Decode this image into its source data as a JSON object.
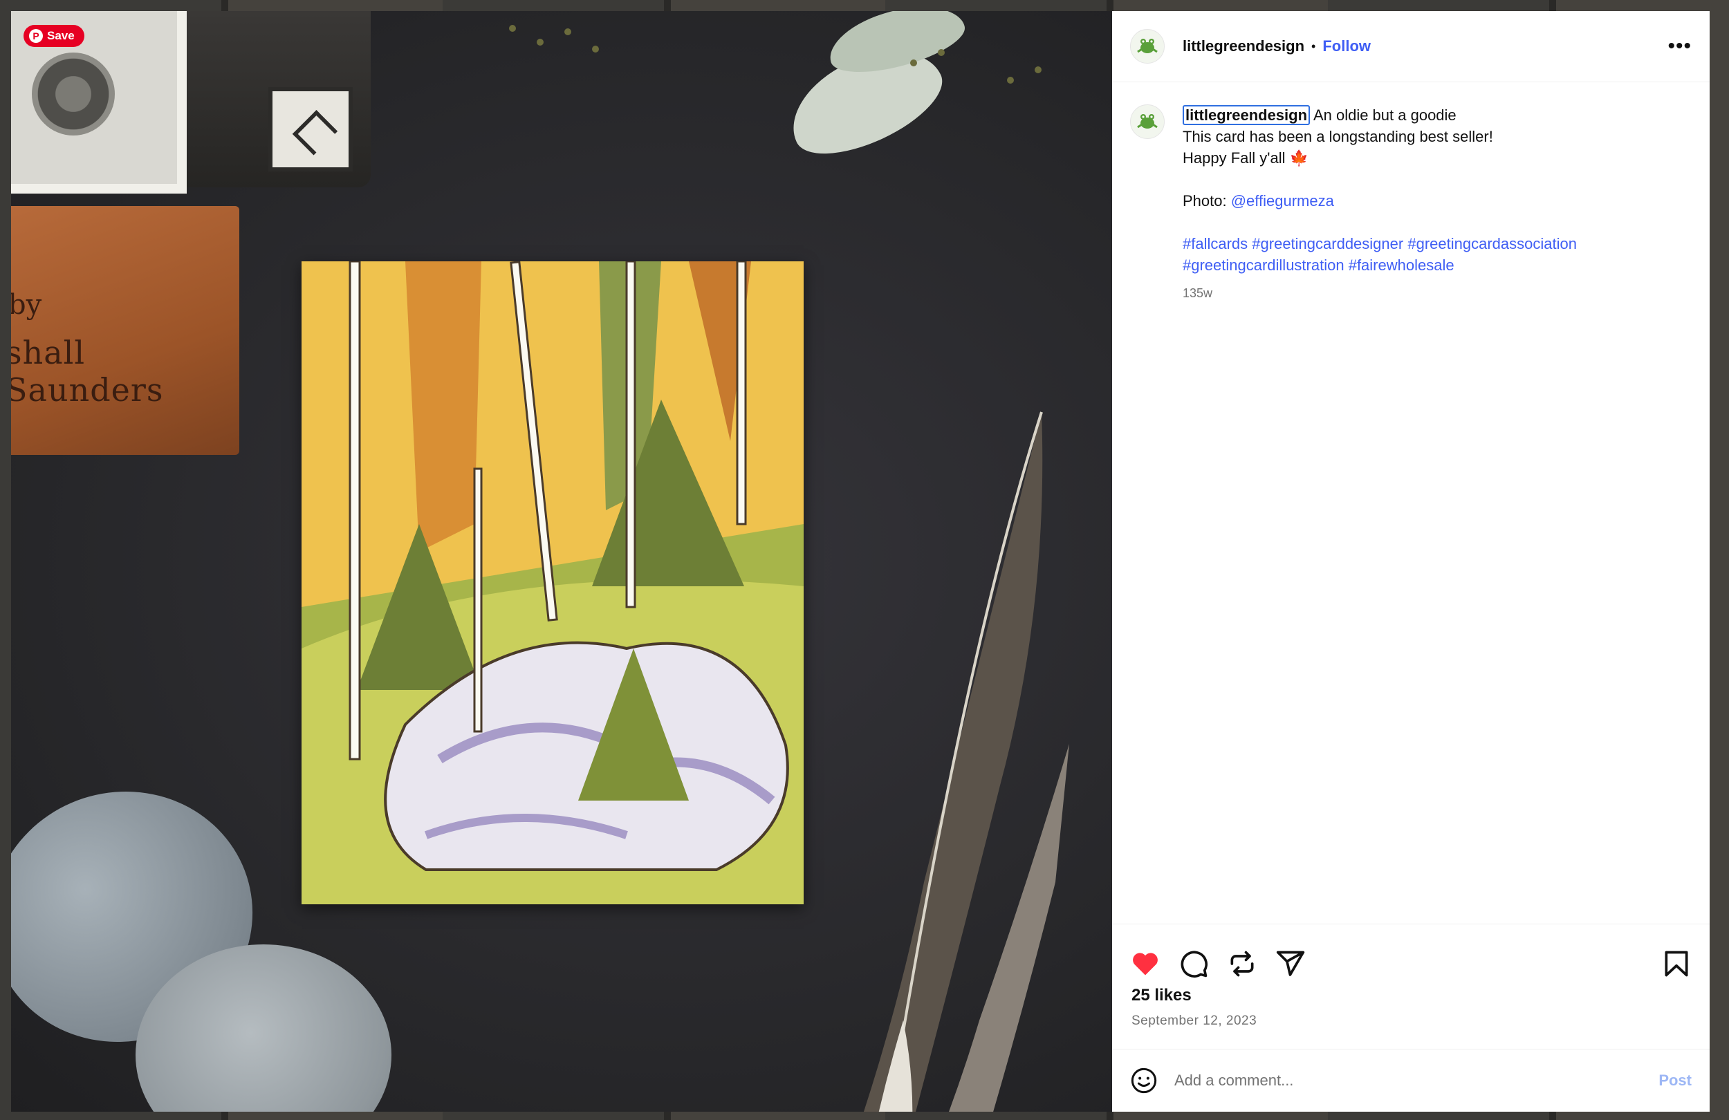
{
  "pin_save": {
    "label": "Save"
  },
  "photo": {
    "book_line1": "by",
    "book_line2": "shall Saunders"
  },
  "header": {
    "username": "littlegreendesign",
    "separator": "•",
    "follow_label": "Follow",
    "more_label": "•••"
  },
  "caption": {
    "username": "littlegreendesign",
    "line1": " An oldie but a goodie",
    "line2": "This card has been a longstanding best seller!",
    "line3": "Happy Fall y'all 🍁",
    "photo_prefix": "Photo: ",
    "photo_credit": "@effiegurmeza",
    "hashtags_line1": [
      "#fallcards",
      "#greetingcarddesigner",
      "#greetingcardassociation"
    ],
    "hashtags_line2": [
      "#greetingcardillustration",
      "#fairewholesale"
    ],
    "time": "135w"
  },
  "actions": {
    "like_color": "#ff3040",
    "icons": [
      "heart-icon",
      "comment-icon",
      "repost-icon",
      "share-icon",
      "bookmark-icon"
    ]
  },
  "stats": {
    "likes": "25 likes",
    "date": "September 12, 2023"
  },
  "comment": {
    "placeholder": "Add a comment...",
    "post_label": "Post"
  },
  "colors": {
    "accent": "#3f5ef4",
    "pinterest": "#e60023",
    "post_disabled": "#9db7f5"
  }
}
